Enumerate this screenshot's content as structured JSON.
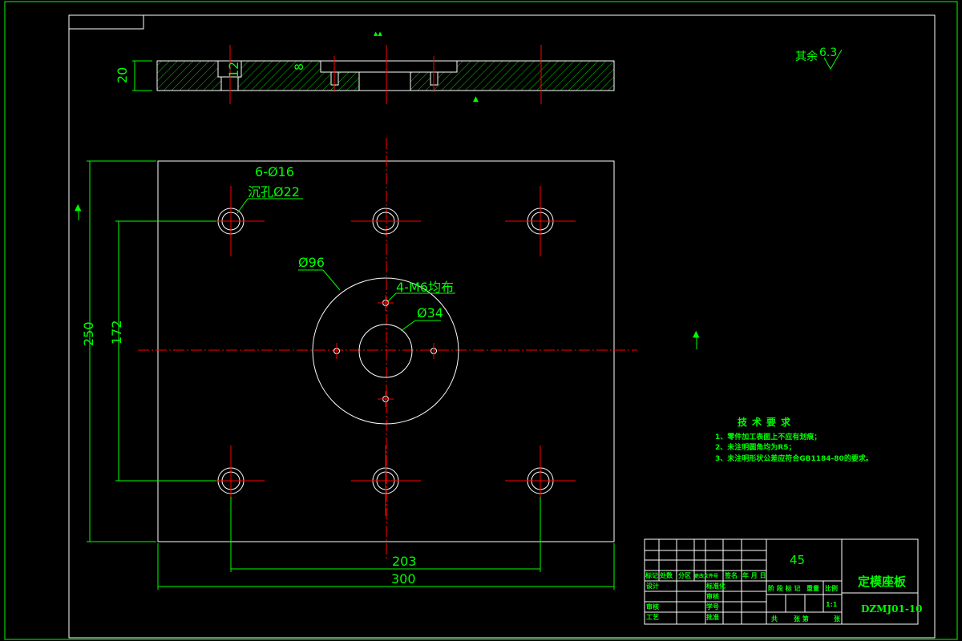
{
  "dimensions": {
    "height_plate": "20",
    "counterbore_depth": "12",
    "thread_depth": "8",
    "hole_spec_line1": "6-Ø16",
    "hole_spec_line2": "沉孔Ø22",
    "circle_96": "Ø96",
    "tapped_holes": "4-M6均布",
    "circle_34": "Ø34",
    "width_overall": "300",
    "width_holes": "203",
    "height_overall": "250",
    "height_holes": "172"
  },
  "surface_finish": {
    "prefix": "其余",
    "value": "6.3"
  },
  "tech_requirements": {
    "title": "技术要求",
    "items": [
      "1、零件加工表面上不应有划痕；",
      "2、未注明圆角均为R5；",
      "3、未注明形状公差应符合GB1184-80的要求。"
    ]
  },
  "title_block": {
    "material": "45",
    "part_name": "定模座板",
    "drawing_no": "DZMJ01-10",
    "scale": "1:1",
    "labels": {
      "mark": "标记",
      "count": "处数",
      "zone": "分区",
      "change_doc": "更改文件号",
      "signature": "签名",
      "date": "年 月 日",
      "design": "设计",
      "standardize": "标准化",
      "review": "审核",
      "craft": "工艺",
      "approve": "批准",
      "check": "审核",
      "student_no": "学号",
      "stage_mark": "阶 段 标 记",
      "weight": "重量",
      "ratio": "比例",
      "total_sheets": "共",
      "sheet": "张 第",
      "sheet_end": "张"
    }
  }
}
